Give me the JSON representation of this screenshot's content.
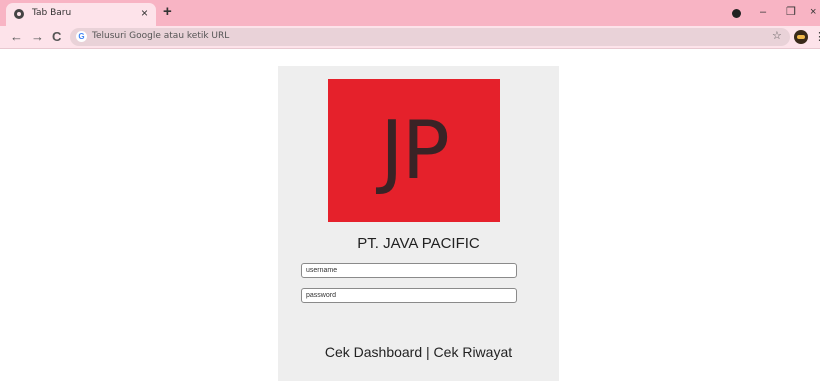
{
  "browser": {
    "tab_title": "Tab Baru",
    "tab_close": "×",
    "new_tab": "+",
    "minimize": "–",
    "restore": "❐",
    "close": "×",
    "omnibox_placeholder": "Telusuri Google atau ketik URL",
    "nav": {
      "back": "←",
      "forward": "→",
      "reload": "C"
    },
    "google_badge": "G",
    "bookmark_star": "☆",
    "menu": "⋮"
  },
  "login": {
    "logo_text": "JP",
    "logo_color": "#e5212b",
    "company_name": "PT. JAVA PACIFIC",
    "username_placeholder": "username",
    "password_placeholder": "password",
    "link_dashboard": "Cek Dashboard",
    "separator": " | ",
    "link_history": "Cek Riwayat"
  }
}
